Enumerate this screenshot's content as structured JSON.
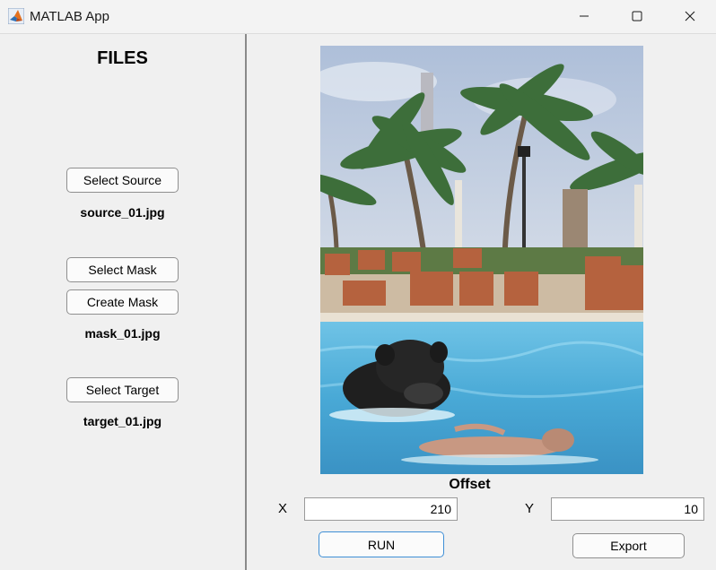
{
  "window": {
    "title": "MATLAB App",
    "icon": "matlab-logo-icon",
    "controls": [
      "minimize-icon",
      "maximize-icon",
      "close-icon"
    ]
  },
  "left": {
    "heading": "FILES",
    "source": {
      "button": "Select Source",
      "file": "source_01.jpg"
    },
    "mask": {
      "select_button": "Select Mask",
      "create_button": "Create Mask",
      "file": "mask_01.jpg"
    },
    "target": {
      "button": "Select Target",
      "file": "target_01.jpg"
    }
  },
  "right": {
    "offset_title": "Offset",
    "x_label": "X",
    "x_value": "210",
    "y_label": "Y",
    "y_value": "10",
    "run_button": "RUN",
    "export_button": "Export"
  },
  "colors": {
    "accent_run_border": "#3f8fd6",
    "panel_bg": "#f0f0f0",
    "divider": "#8a8a8a"
  }
}
